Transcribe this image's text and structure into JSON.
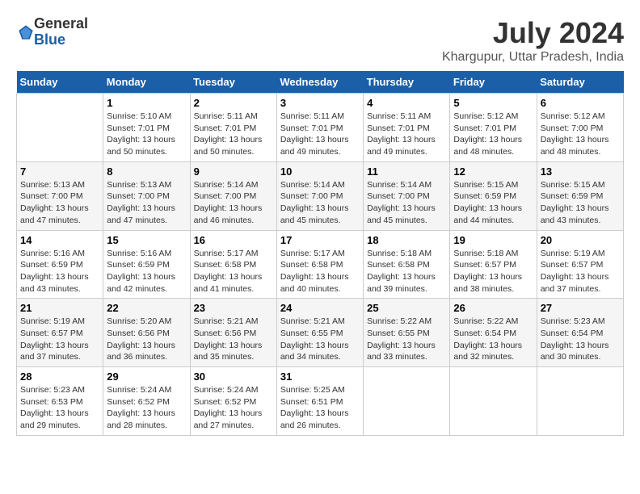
{
  "logo": {
    "general": "General",
    "blue": "Blue"
  },
  "title": {
    "month_year": "July 2024",
    "location": "Khargupur, Uttar Pradesh, India"
  },
  "weekdays": [
    "Sunday",
    "Monday",
    "Tuesday",
    "Wednesday",
    "Thursday",
    "Friday",
    "Saturday"
  ],
  "weeks": [
    [
      {
        "day": "",
        "sunrise": "",
        "sunset": "",
        "daylight": ""
      },
      {
        "day": "1",
        "sunrise": "Sunrise: 5:10 AM",
        "sunset": "Sunset: 7:01 PM",
        "daylight": "Daylight: 13 hours and 50 minutes."
      },
      {
        "day": "2",
        "sunrise": "Sunrise: 5:11 AM",
        "sunset": "Sunset: 7:01 PM",
        "daylight": "Daylight: 13 hours and 50 minutes."
      },
      {
        "day": "3",
        "sunrise": "Sunrise: 5:11 AM",
        "sunset": "Sunset: 7:01 PM",
        "daylight": "Daylight: 13 hours and 49 minutes."
      },
      {
        "day": "4",
        "sunrise": "Sunrise: 5:11 AM",
        "sunset": "Sunset: 7:01 PM",
        "daylight": "Daylight: 13 hours and 49 minutes."
      },
      {
        "day": "5",
        "sunrise": "Sunrise: 5:12 AM",
        "sunset": "Sunset: 7:01 PM",
        "daylight": "Daylight: 13 hours and 48 minutes."
      },
      {
        "day": "6",
        "sunrise": "Sunrise: 5:12 AM",
        "sunset": "Sunset: 7:00 PM",
        "daylight": "Daylight: 13 hours and 48 minutes."
      }
    ],
    [
      {
        "day": "7",
        "sunrise": "Sunrise: 5:13 AM",
        "sunset": "Sunset: 7:00 PM",
        "daylight": "Daylight: 13 hours and 47 minutes."
      },
      {
        "day": "8",
        "sunrise": "Sunrise: 5:13 AM",
        "sunset": "Sunset: 7:00 PM",
        "daylight": "Daylight: 13 hours and 47 minutes."
      },
      {
        "day": "9",
        "sunrise": "Sunrise: 5:14 AM",
        "sunset": "Sunset: 7:00 PM",
        "daylight": "Daylight: 13 hours and 46 minutes."
      },
      {
        "day": "10",
        "sunrise": "Sunrise: 5:14 AM",
        "sunset": "Sunset: 7:00 PM",
        "daylight": "Daylight: 13 hours and 45 minutes."
      },
      {
        "day": "11",
        "sunrise": "Sunrise: 5:14 AM",
        "sunset": "Sunset: 7:00 PM",
        "daylight": "Daylight: 13 hours and 45 minutes."
      },
      {
        "day": "12",
        "sunrise": "Sunrise: 5:15 AM",
        "sunset": "Sunset: 6:59 PM",
        "daylight": "Daylight: 13 hours and 44 minutes."
      },
      {
        "day": "13",
        "sunrise": "Sunrise: 5:15 AM",
        "sunset": "Sunset: 6:59 PM",
        "daylight": "Daylight: 13 hours and 43 minutes."
      }
    ],
    [
      {
        "day": "14",
        "sunrise": "Sunrise: 5:16 AM",
        "sunset": "Sunset: 6:59 PM",
        "daylight": "Daylight: 13 hours and 43 minutes."
      },
      {
        "day": "15",
        "sunrise": "Sunrise: 5:16 AM",
        "sunset": "Sunset: 6:59 PM",
        "daylight": "Daylight: 13 hours and 42 minutes."
      },
      {
        "day": "16",
        "sunrise": "Sunrise: 5:17 AM",
        "sunset": "Sunset: 6:58 PM",
        "daylight": "Daylight: 13 hours and 41 minutes."
      },
      {
        "day": "17",
        "sunrise": "Sunrise: 5:17 AM",
        "sunset": "Sunset: 6:58 PM",
        "daylight": "Daylight: 13 hours and 40 minutes."
      },
      {
        "day": "18",
        "sunrise": "Sunrise: 5:18 AM",
        "sunset": "Sunset: 6:58 PM",
        "daylight": "Daylight: 13 hours and 39 minutes."
      },
      {
        "day": "19",
        "sunrise": "Sunrise: 5:18 AM",
        "sunset": "Sunset: 6:57 PM",
        "daylight": "Daylight: 13 hours and 38 minutes."
      },
      {
        "day": "20",
        "sunrise": "Sunrise: 5:19 AM",
        "sunset": "Sunset: 6:57 PM",
        "daylight": "Daylight: 13 hours and 37 minutes."
      }
    ],
    [
      {
        "day": "21",
        "sunrise": "Sunrise: 5:19 AM",
        "sunset": "Sunset: 6:57 PM",
        "daylight": "Daylight: 13 hours and 37 minutes."
      },
      {
        "day": "22",
        "sunrise": "Sunrise: 5:20 AM",
        "sunset": "Sunset: 6:56 PM",
        "daylight": "Daylight: 13 hours and 36 minutes."
      },
      {
        "day": "23",
        "sunrise": "Sunrise: 5:21 AM",
        "sunset": "Sunset: 6:56 PM",
        "daylight": "Daylight: 13 hours and 35 minutes."
      },
      {
        "day": "24",
        "sunrise": "Sunrise: 5:21 AM",
        "sunset": "Sunset: 6:55 PM",
        "daylight": "Daylight: 13 hours and 34 minutes."
      },
      {
        "day": "25",
        "sunrise": "Sunrise: 5:22 AM",
        "sunset": "Sunset: 6:55 PM",
        "daylight": "Daylight: 13 hours and 33 minutes."
      },
      {
        "day": "26",
        "sunrise": "Sunrise: 5:22 AM",
        "sunset": "Sunset: 6:54 PM",
        "daylight": "Daylight: 13 hours and 32 minutes."
      },
      {
        "day": "27",
        "sunrise": "Sunrise: 5:23 AM",
        "sunset": "Sunset: 6:54 PM",
        "daylight": "Daylight: 13 hours and 30 minutes."
      }
    ],
    [
      {
        "day": "28",
        "sunrise": "Sunrise: 5:23 AM",
        "sunset": "Sunset: 6:53 PM",
        "daylight": "Daylight: 13 hours and 29 minutes."
      },
      {
        "day": "29",
        "sunrise": "Sunrise: 5:24 AM",
        "sunset": "Sunset: 6:52 PM",
        "daylight": "Daylight: 13 hours and 28 minutes."
      },
      {
        "day": "30",
        "sunrise": "Sunrise: 5:24 AM",
        "sunset": "Sunset: 6:52 PM",
        "daylight": "Daylight: 13 hours and 27 minutes."
      },
      {
        "day": "31",
        "sunrise": "Sunrise: 5:25 AM",
        "sunset": "Sunset: 6:51 PM",
        "daylight": "Daylight: 13 hours and 26 minutes."
      },
      {
        "day": "",
        "sunrise": "",
        "sunset": "",
        "daylight": ""
      },
      {
        "day": "",
        "sunrise": "",
        "sunset": "",
        "daylight": ""
      },
      {
        "day": "",
        "sunrise": "",
        "sunset": "",
        "daylight": ""
      }
    ]
  ]
}
